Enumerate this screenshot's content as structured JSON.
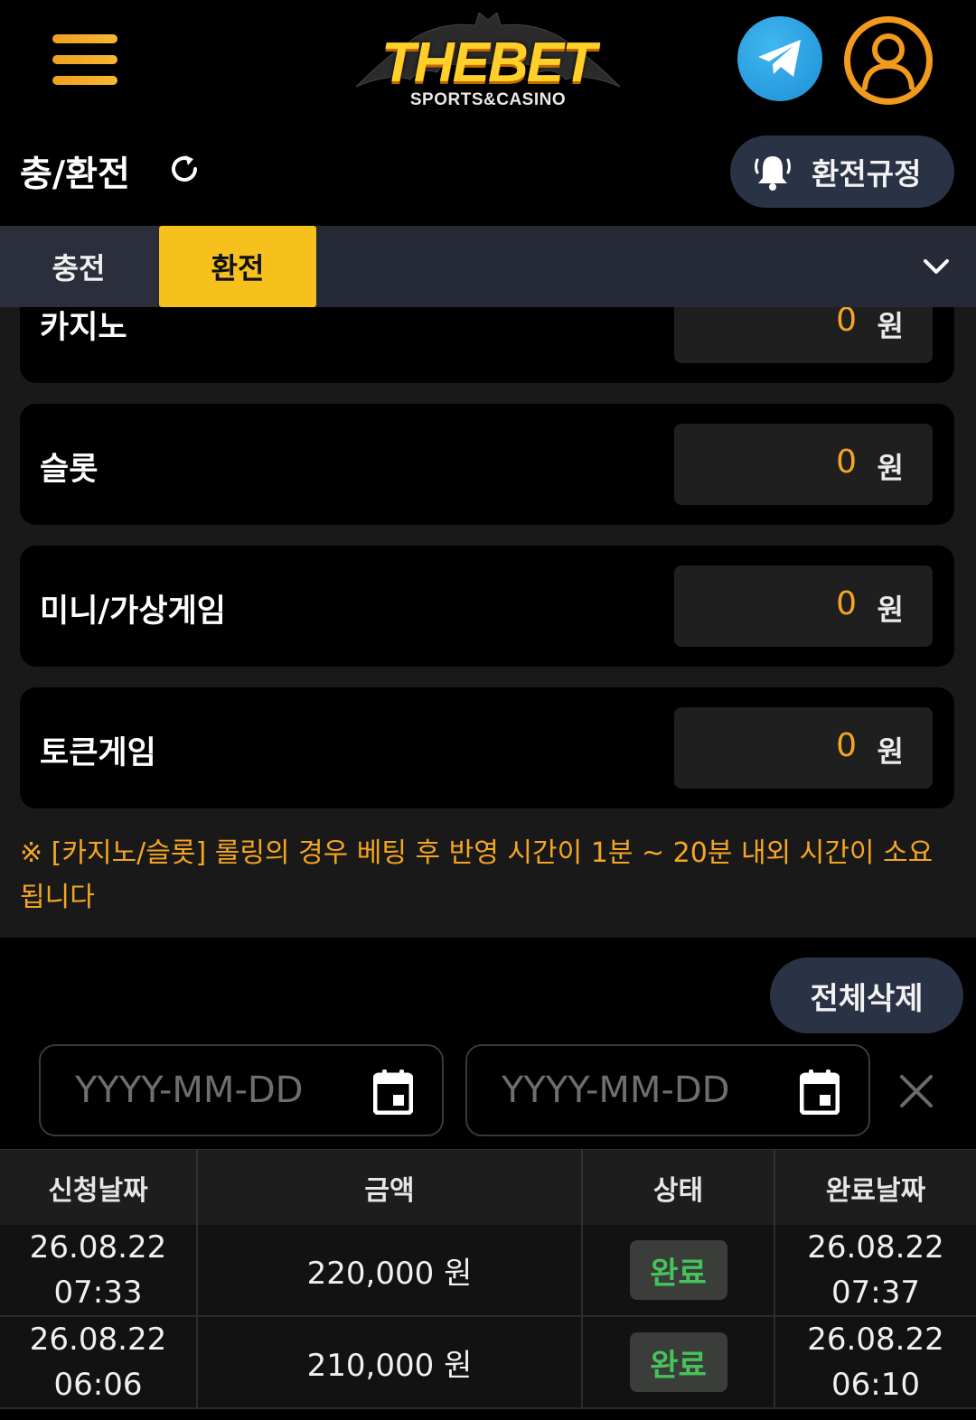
{
  "header": {
    "logo_main": "THEBET",
    "logo_sub": "SPORTS&CASINO",
    "menu_icon": "hamburger-icon",
    "telegram_icon": "telegram-icon",
    "profile_icon": "user-icon"
  },
  "title_bar": {
    "title": "충/환전",
    "refresh_icon": "refresh-icon",
    "rules_button": "환전규정",
    "rules_icon": "bell-icon"
  },
  "tabs": [
    {
      "label": "충전",
      "active": false
    },
    {
      "label": "환전",
      "active": true
    }
  ],
  "rolling_cards": [
    {
      "label": "카지노",
      "value": "0",
      "unit": "원"
    },
    {
      "label": "슬롯",
      "value": "0",
      "unit": "원"
    },
    {
      "label": "미니/가상게임",
      "value": "0",
      "unit": "원"
    },
    {
      "label": "토큰게임",
      "value": "0",
      "unit": "원"
    }
  ],
  "notice": "※ [카지노/슬롯] 롤링의 경우 베팅 후 반영 시간이 1분 ~ 20분 내외 시간이 소요됩니다",
  "filter": {
    "delete_all": "전체삭제",
    "start_placeholder": "YYYY-MM-DD",
    "end_placeholder": "YYYY-MM-DD"
  },
  "table": {
    "headers": [
      "신청날짜",
      "금액",
      "상태",
      "완료날짜"
    ],
    "rows": [
      {
        "req_date": "26.08.22",
        "req_time": "07:33",
        "amount": "220,000 원",
        "status": "완료",
        "done_date": "26.08.22",
        "done_time": "07:37"
      },
      {
        "req_date": "26.08.22",
        "req_time": "06:06",
        "amount": "210,000 원",
        "status": "완료",
        "done_date": "26.08.22",
        "done_time": "06:10"
      }
    ]
  },
  "colors": {
    "accent_yellow": "#f6c11d",
    "accent_orange": "#f4a623",
    "status_green": "#46c35a",
    "pill_bg": "#2a3246"
  }
}
